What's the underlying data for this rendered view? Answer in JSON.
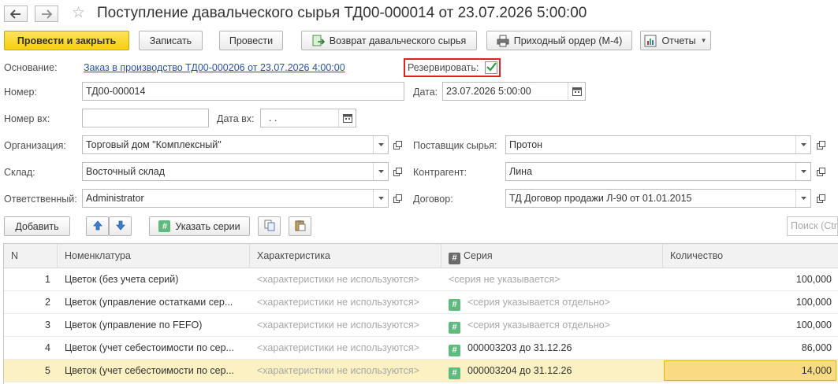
{
  "window": {
    "title": "Поступление давальческого сырья ТД00-000014 от 23.07.2026 5:00:00"
  },
  "icons": {
    "back": "arrow-left-icon",
    "forward": "arrow-right-icon",
    "favorite": "star-icon"
  },
  "toolbar": {
    "post_close": "Провести и закрыть",
    "save": "Записать",
    "post": "Провести",
    "return_raw": "Возврат давальческого сырья",
    "receipt_order": "Приходный ордер (М-4)",
    "reports": "Отчеты"
  },
  "form": {
    "basis_label": "Основание:",
    "basis_value": "Заказ в производство ТД00-000206 от 23.07.2026 4:00:00",
    "reserve_label": "Резервировать:",
    "reserve_checked": true,
    "number_label": "Номер:",
    "number_value": "ТД00-000014",
    "date_label": "Дата:",
    "date_value": "23.07.2026  5:00:00",
    "in_number_label": "Номер вх:",
    "in_number_value": "",
    "in_date_label": "Дата вх:",
    "in_date_value": " .  .",
    "org_label": "Организация:",
    "org_value": "Торговый дом \"Комплексный\"",
    "supplier_label": "Поставщик сырья:",
    "supplier_value": "Протон",
    "warehouse_label": "Склад:",
    "warehouse_value": "Восточный склад",
    "counterparty_label": "Контрагент:",
    "counterparty_value": "Лина",
    "responsible_label": "Ответственный:",
    "responsible_value": "Administrator",
    "contract_label": "Договор:",
    "contract_value": "ТД Договор продажи Л-90 от 01.01.2015"
  },
  "table_toolbar": {
    "add": "Добавить",
    "series": "Указать серии",
    "search_placeholder": "Поиск (Ctrl"
  },
  "table": {
    "columns": [
      "N",
      "Номенклатура",
      "Характеристика",
      "Серия",
      "Количество"
    ],
    "rows": [
      {
        "n": "1",
        "item": "Цветок (без учета серий)",
        "char": "<характеристики не используются>",
        "series": "<серия не указывается>",
        "series_icon": false,
        "series_gray": true,
        "qty": "100,000"
      },
      {
        "n": "2",
        "item": "Цветок (управление остатками сер...",
        "char": "<характеристики не используются>",
        "series": "<серия указывается отдельно>",
        "series_icon": true,
        "series_gray": true,
        "qty": "100,000"
      },
      {
        "n": "3",
        "item": "Цветок (управление по FEFO)",
        "char": "<характеристики не используются>",
        "series": "<серия указывается отдельно>",
        "series_icon": true,
        "series_gray": true,
        "qty": "100,000"
      },
      {
        "n": "4",
        "item": "Цветок (учет себестоимости по сер...",
        "char": "<характеристики не используются>",
        "series": "000003203 до 31.12.26",
        "series_icon": true,
        "series_gray": false,
        "qty": "86,000"
      },
      {
        "n": "5",
        "item": "Цветок (учет себестоимости по сер...",
        "char": "<характеристики не используются>",
        "series": "000003204 до 31.12.26",
        "series_icon": true,
        "series_gray": false,
        "qty": "14,000"
      }
    ]
  }
}
